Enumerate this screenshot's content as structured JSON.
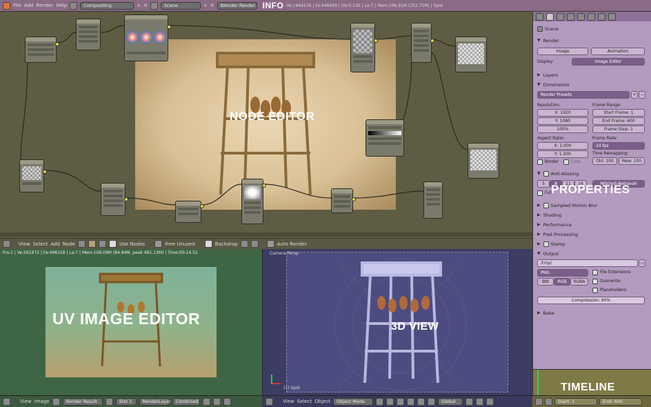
{
  "info_header": {
    "menus": [
      "File",
      "Add",
      "Render",
      "Help"
    ],
    "screen": "Compositing",
    "scene": "Scene",
    "engine": "Blender Render",
    "stats": "Ve:1944276 | Fa:946409 | Ob:0-136 | La:7 | Mem:106.91M (352.75M) | Spot"
  },
  "labels": {
    "info": "INFO",
    "node_editor": "NODE EDITOR",
    "uv_image_editor": "UV IMAGE EDITOR",
    "view_3d": "3D VIEW",
    "properties": "PROPERTIES",
    "timeline": "TIMELINE"
  },
  "node_header": {
    "menus": [
      "View",
      "Select",
      "Add",
      "Node"
    ],
    "use_nodes": "Use Nodes",
    "free_unused": "Free Unused",
    "backdrop": "Backdrop",
    "auto_render": "Auto Render"
  },
  "image_editor": {
    "stats": "Fra:1 | Ve:561972 | Fa:498158 | La:7 | Mem:106.09M (84.84M, peak 491.13M) | Time:00:14.52",
    "menus": [
      "View",
      "Image"
    ],
    "image": "Render Result",
    "slot": "Slot 1",
    "layer": "RenderLayer",
    "pass": "Combined"
  },
  "view3d": {
    "label": "Camera Persp",
    "object_label": "(1) Spot",
    "menus": [
      "View",
      "Select",
      "Object"
    ],
    "mode": "Object Mode",
    "orientation": "Global"
  },
  "properties": {
    "scene_label": "Scene",
    "render_panel": "Render",
    "image_btn": "Image",
    "animation_btn": "Animation",
    "display_label": "Display:",
    "display_value": "Image Editor",
    "layers": "Layers",
    "dimensions": "Dimensions",
    "render_presets": "Render Presets",
    "resolution_label": "Resolution:",
    "res_x": "X: 1920",
    "res_y": "Y: 1080",
    "res_pct": "100%",
    "frame_range_label": "Frame Range:",
    "start_frame": "Start Frame: 1",
    "end_frame": "End Frame: 600",
    "frame_step": "Frame Step: 1",
    "aspect_label": "Aspect Ratio:",
    "aspect_x": "X: 1.000",
    "aspect_y": "Y: 1.000",
    "frame_rate_label": "Frame Rate:",
    "fps": "24 fps",
    "time_remap": "Time Remapping:",
    "old": "Old: 100",
    "new": "New: 100",
    "border": "Border",
    "crop": "Crop",
    "anti_aliasing": "Anti-Aliasing",
    "aa_samples": [
      "5",
      "8",
      "11",
      "16"
    ],
    "aa_filter": "Mitchell-Netravali",
    "full_sample": "Full",
    "collapsed": [
      "Sampled Motion Blur",
      "Shading",
      "Performance",
      "Post Processing",
      "Stamp"
    ],
    "output": "Output",
    "output_path": "/tmp/",
    "format": "PNG",
    "file_ext": "File Extensions",
    "overwrite": "Overwrite",
    "placeholders": "Placeholders",
    "bw": "BW",
    "rgb": "RGB",
    "rgba": "RGBA",
    "compression": "Compression: 90%",
    "bake": "Bake"
  },
  "timeline": {
    "start": "Start: 1",
    "end": "End: 600"
  },
  "colors": {
    "node_bg": "#5e5c42",
    "properties_bg": "#b39abf",
    "image_editor_bg": "#3e6644",
    "view3d_bg": "#3c3c64",
    "timeline_bg": "#7e7a46"
  }
}
